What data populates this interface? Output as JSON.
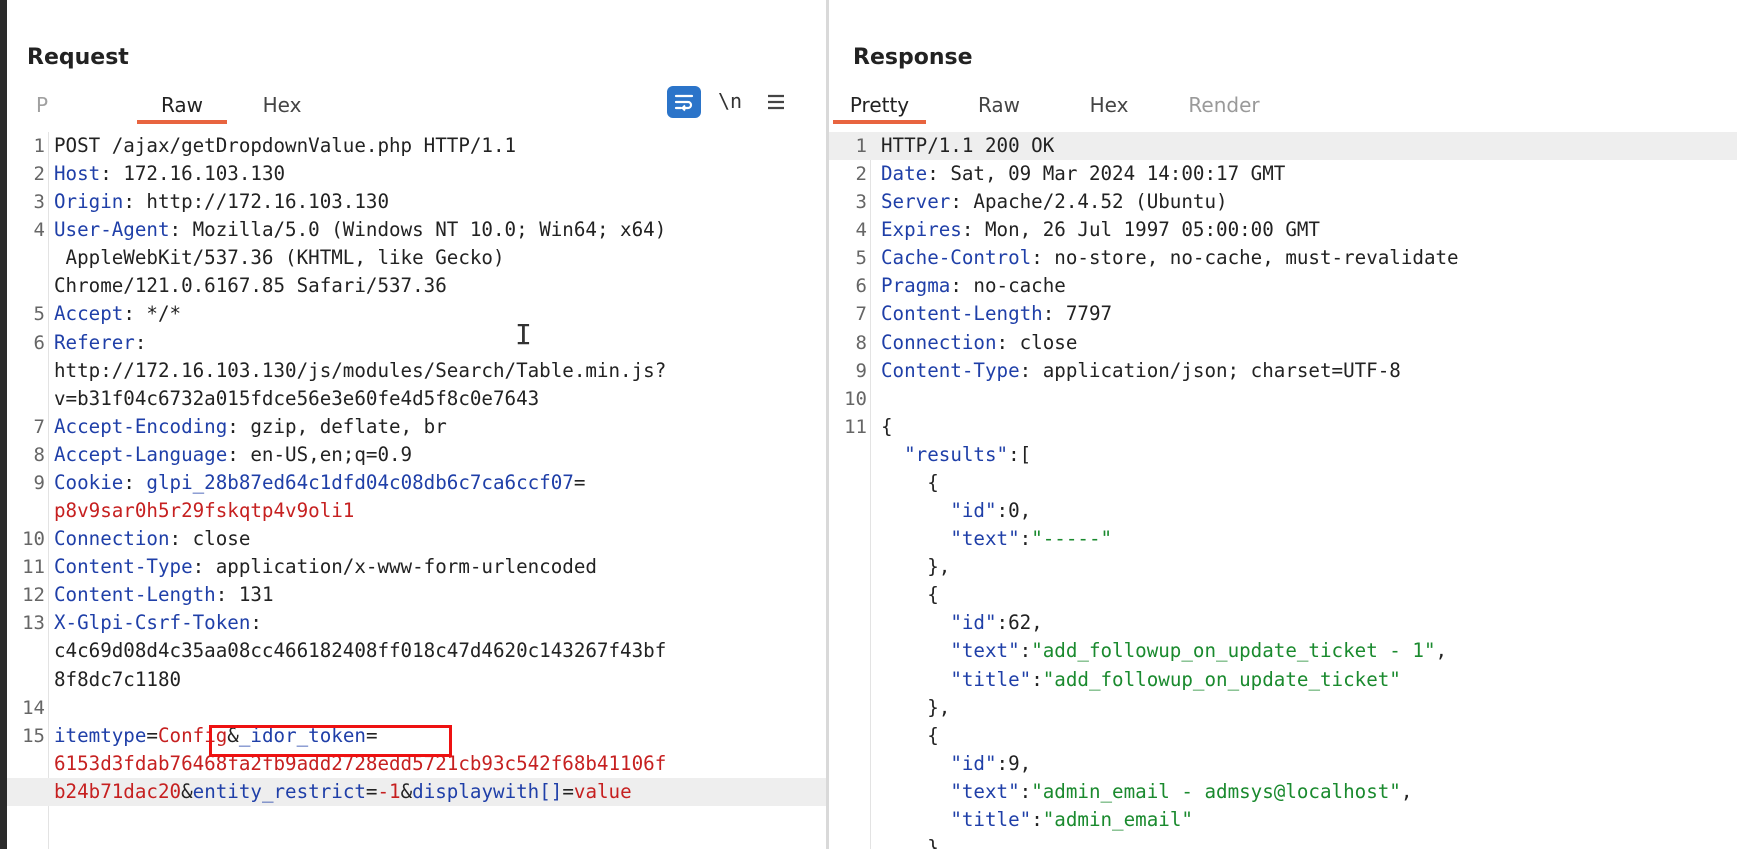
{
  "request": {
    "title": "Request",
    "tabs": [
      {
        "label": "P",
        "state": "faded"
      },
      {
        "label": "Raw",
        "state": "active"
      },
      {
        "label": "Hex",
        "state": "normal"
      }
    ],
    "tools": {
      "wrap_icon": "wrap-lines-icon",
      "newline_label": "\\n",
      "menu_icon": "hamburger-menu-icon"
    },
    "lines": [
      {
        "n": "1",
        "parts": [
          [
            "p",
            "POST /ajax/getDropdownValue.php HTTP/1.1"
          ]
        ]
      },
      {
        "n": "2",
        "parts": [
          [
            "k",
            "Host"
          ],
          [
            "p",
            ": 172.16.103.130"
          ]
        ]
      },
      {
        "n": "3",
        "parts": [
          [
            "k",
            "Origin"
          ],
          [
            "p",
            ": http://172.16.103.130"
          ]
        ]
      },
      {
        "n": "4",
        "parts": [
          [
            "k",
            "User-Agent"
          ],
          [
            "p",
            ": Mozilla/5.0 (Windows NT 10.0; Win64; x64)"
          ]
        ]
      },
      {
        "n": "",
        "parts": [
          [
            "p",
            " AppleWebKit/537.36 (KHTML, like Gecko)"
          ]
        ]
      },
      {
        "n": "",
        "parts": [
          [
            "p",
            "Chrome/121.0.6167.85 Safari/537.36"
          ]
        ]
      },
      {
        "n": "5",
        "parts": [
          [
            "k",
            "Accept"
          ],
          [
            "p",
            ": */*"
          ]
        ]
      },
      {
        "n": "6",
        "parts": [
          [
            "k",
            "Referer"
          ],
          [
            "p",
            ":"
          ]
        ]
      },
      {
        "n": "",
        "parts": [
          [
            "p",
            "http://172.16.103.130/js/modules/Search/Table.min.js?"
          ]
        ]
      },
      {
        "n": "",
        "parts": [
          [
            "p",
            "v=b31f04c6732a015fdce56e3e60fe4d5f8c0e7643"
          ]
        ]
      },
      {
        "n": "7",
        "parts": [
          [
            "k",
            "Accept-Encoding"
          ],
          [
            "p",
            ": gzip, deflate, br"
          ]
        ]
      },
      {
        "n": "8",
        "parts": [
          [
            "k",
            "Accept-Language"
          ],
          [
            "p",
            ": en-US,en;q=0.9"
          ]
        ]
      },
      {
        "n": "9",
        "parts": [
          [
            "k",
            "Cookie"
          ],
          [
            "p",
            ": "
          ],
          [
            "k",
            "glpi_28b87ed64c1dfd04c08db6c7ca6ccf07"
          ],
          [
            "p",
            "="
          ]
        ]
      },
      {
        "n": "",
        "parts": [
          [
            "r",
            "p8v9sar0h5r29fskqtp4v9oli1"
          ]
        ]
      },
      {
        "n": "10",
        "parts": [
          [
            "k",
            "Connection"
          ],
          [
            "p",
            ": close"
          ]
        ]
      },
      {
        "n": "11",
        "parts": [
          [
            "k",
            "Content-Type"
          ],
          [
            "p",
            ": application/x-www-form-urlencoded"
          ]
        ]
      },
      {
        "n": "12",
        "parts": [
          [
            "k",
            "Content-Length"
          ],
          [
            "p",
            ": 131"
          ]
        ]
      },
      {
        "n": "13",
        "parts": [
          [
            "k",
            "X-Glpi-Csrf-Token"
          ],
          [
            "p",
            ":"
          ]
        ]
      },
      {
        "n": "",
        "parts": [
          [
            "p",
            "c4c69d08d4c35aa08cc466182408ff018c47d4620c143267f43bf"
          ]
        ]
      },
      {
        "n": "",
        "parts": [
          [
            "p",
            "8f8dc7c1180"
          ]
        ]
      },
      {
        "n": "14",
        "parts": []
      },
      {
        "n": "15",
        "parts": [
          [
            "k",
            "itemtype"
          ],
          [
            "p",
            "="
          ],
          [
            "r",
            "Config"
          ],
          [
            "p",
            "&"
          ],
          [
            "k",
            "_idor_token"
          ],
          [
            "p",
            "="
          ]
        ]
      },
      {
        "n": "",
        "parts": [
          [
            "r",
            "6153d3fdab76468fa2fb9add2728edd5721cb93c542f68b41106f"
          ]
        ]
      },
      {
        "n": "",
        "hl": true,
        "parts": [
          [
            "r",
            "b24b71dac20"
          ],
          [
            "p",
            "&"
          ],
          [
            "k",
            "entity_restrict"
          ],
          [
            "p",
            "="
          ],
          [
            "r",
            "-1"
          ],
          [
            "p",
            "&"
          ],
          [
            "k",
            "displaywith[]"
          ],
          [
            "p",
            "="
          ],
          [
            "r",
            "value"
          ]
        ]
      }
    ]
  },
  "response": {
    "title": "Response",
    "tabs": [
      {
        "label": "Pretty",
        "state": "active"
      },
      {
        "label": "Raw",
        "state": "normal"
      },
      {
        "label": "Hex",
        "state": "normal"
      },
      {
        "label": "Render",
        "state": "disabled"
      }
    ],
    "lines": [
      {
        "n": "1",
        "hl": true,
        "parts": [
          [
            "p",
            "HTTP/1.1 200 OK"
          ]
        ]
      },
      {
        "n": "2",
        "parts": [
          [
            "k",
            "Date"
          ],
          [
            "p",
            ": Sat, 09 Mar 2024 14:00:17 GMT"
          ]
        ]
      },
      {
        "n": "3",
        "parts": [
          [
            "k",
            "Server"
          ],
          [
            "p",
            ": Apache/2.4.52 (Ubuntu)"
          ]
        ]
      },
      {
        "n": "4",
        "parts": [
          [
            "k",
            "Expires"
          ],
          [
            "p",
            ": Mon, 26 Jul 1997 05:00:00 GMT"
          ]
        ]
      },
      {
        "n": "5",
        "parts": [
          [
            "k",
            "Cache-Control"
          ],
          [
            "p",
            ": no-store, no-cache, must-revalidate"
          ]
        ]
      },
      {
        "n": "6",
        "parts": [
          [
            "k",
            "Pragma"
          ],
          [
            "p",
            ": no-cache"
          ]
        ]
      },
      {
        "n": "7",
        "parts": [
          [
            "k",
            "Content-Length"
          ],
          [
            "p",
            ": 7797"
          ]
        ]
      },
      {
        "n": "8",
        "parts": [
          [
            "k",
            "Connection"
          ],
          [
            "p",
            ": close"
          ]
        ]
      },
      {
        "n": "9",
        "parts": [
          [
            "k",
            "Content-Type"
          ],
          [
            "p",
            ": application/json; charset=UTF-8"
          ]
        ]
      },
      {
        "n": "10",
        "parts": []
      },
      {
        "n": "11",
        "parts": [
          [
            "p",
            "{"
          ]
        ]
      },
      {
        "n": "",
        "parts": [
          [
            "p",
            "  "
          ],
          [
            "q",
            "\"results\""
          ],
          [
            "p",
            ":["
          ]
        ]
      },
      {
        "n": "",
        "parts": [
          [
            "p",
            "    {"
          ]
        ]
      },
      {
        "n": "",
        "parts": [
          [
            "p",
            "      "
          ],
          [
            "q",
            "\"id\""
          ],
          [
            "p",
            ":0,"
          ]
        ]
      },
      {
        "n": "",
        "parts": [
          [
            "p",
            "      "
          ],
          [
            "q",
            "\"text\""
          ],
          [
            "p",
            ":"
          ],
          [
            "s",
            "\"-----\""
          ]
        ]
      },
      {
        "n": "",
        "parts": [
          [
            "p",
            "    },"
          ]
        ]
      },
      {
        "n": "",
        "parts": [
          [
            "p",
            "    {"
          ]
        ]
      },
      {
        "n": "",
        "parts": [
          [
            "p",
            "      "
          ],
          [
            "q",
            "\"id\""
          ],
          [
            "p",
            ":62,"
          ]
        ]
      },
      {
        "n": "",
        "parts": [
          [
            "p",
            "      "
          ],
          [
            "q",
            "\"text\""
          ],
          [
            "p",
            ":"
          ],
          [
            "s",
            "\"add_followup_on_update_ticket - 1\""
          ],
          [
            "p",
            ","
          ]
        ]
      },
      {
        "n": "",
        "parts": [
          [
            "p",
            "      "
          ],
          [
            "q",
            "\"title\""
          ],
          [
            "p",
            ":"
          ],
          [
            "s",
            "\"add_followup_on_update_ticket\""
          ]
        ]
      },
      {
        "n": "",
        "parts": [
          [
            "p",
            "    },"
          ]
        ]
      },
      {
        "n": "",
        "parts": [
          [
            "p",
            "    {"
          ]
        ]
      },
      {
        "n": "",
        "parts": [
          [
            "p",
            "      "
          ],
          [
            "q",
            "\"id\""
          ],
          [
            "p",
            ":9,"
          ]
        ]
      },
      {
        "n": "",
        "parts": [
          [
            "p",
            "      "
          ],
          [
            "q",
            "\"text\""
          ],
          [
            "p",
            ":"
          ],
          [
            "s",
            "\"admin_email - admsys@localhost\""
          ],
          [
            "p",
            ","
          ]
        ]
      },
      {
        "n": "",
        "parts": [
          [
            "p",
            "      "
          ],
          [
            "q",
            "\"title\""
          ],
          [
            "p",
            ":"
          ],
          [
            "s",
            "\"admin_email\""
          ]
        ]
      },
      {
        "n": "",
        "parts": [
          [
            "p",
            "    }"
          ]
        ]
      }
    ]
  },
  "colors": {
    "accent": "#e8643f",
    "key": "#1f3fa8",
    "value_red": "#c62020",
    "string_green": "#1a8a2e",
    "wrap_button": "#2b74c9",
    "highlight_box": "#ee1111"
  }
}
